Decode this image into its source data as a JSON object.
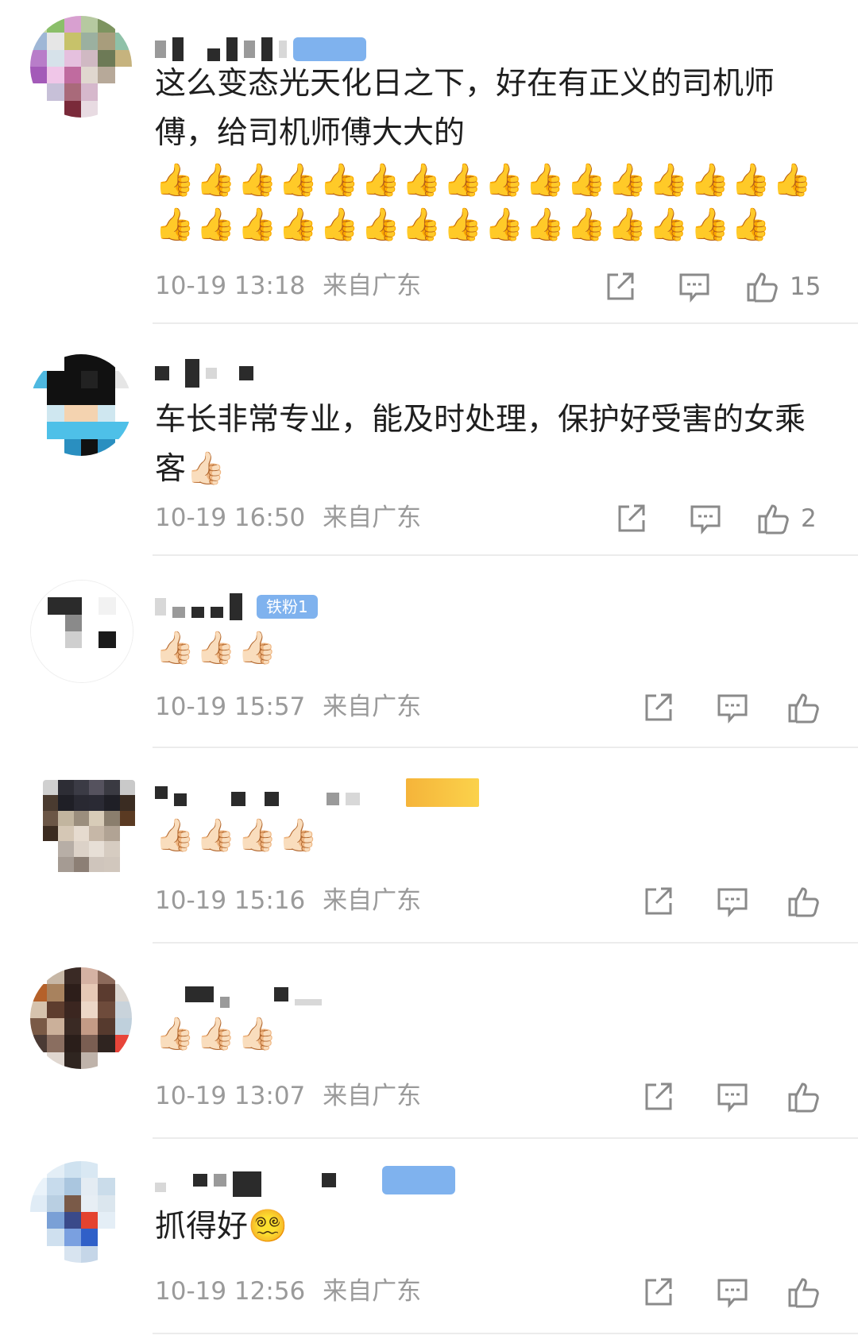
{
  "comments": [
    {
      "text": "这么变态光天化日之下，好在有正义的司机师傅，给司机师傅大大的",
      "emojis": "👍👍👍👍👍👍👍👍👍👍👍👍👍👍👍👍👍👍👍👍👍👍👍👍👍👍👍👍👍👍👍",
      "time": "10-19 13:18",
      "location": "来自广东",
      "likes": "15"
    },
    {
      "text": "车长非常专业，能及时处理，保护好受害的女乘客",
      "emojis": "👍🏻",
      "time": "10-19 16:50",
      "location": "来自广东",
      "likes": "2"
    },
    {
      "text": "",
      "emojis": "👍🏻👍🏻👍🏻",
      "badge": "铁粉1",
      "time": "10-19 15:57",
      "location": "来自广东",
      "likes": ""
    },
    {
      "text": "",
      "emojis": "👍🏻👍🏻👍🏻👍🏻",
      "time": "10-19 15:16",
      "location": "来自广东",
      "likes": ""
    },
    {
      "text": "",
      "emojis": "👍🏻👍🏻👍🏻",
      "time": "10-19 13:07",
      "location": "来自广东",
      "likes": ""
    },
    {
      "text": "抓得好",
      "emojis": "😵‍💫",
      "time": "10-19 12:56",
      "location": "来自广东",
      "likes": ""
    }
  ],
  "icons": {
    "share": "share-icon",
    "reply": "comment-icon",
    "like": "thumbs-up-icon"
  },
  "colors": {
    "meta_text": "#9a9a9a",
    "badge_blue": "#7fb2ee",
    "badge_gold": "#f5b43a",
    "divider": "#ececec"
  }
}
